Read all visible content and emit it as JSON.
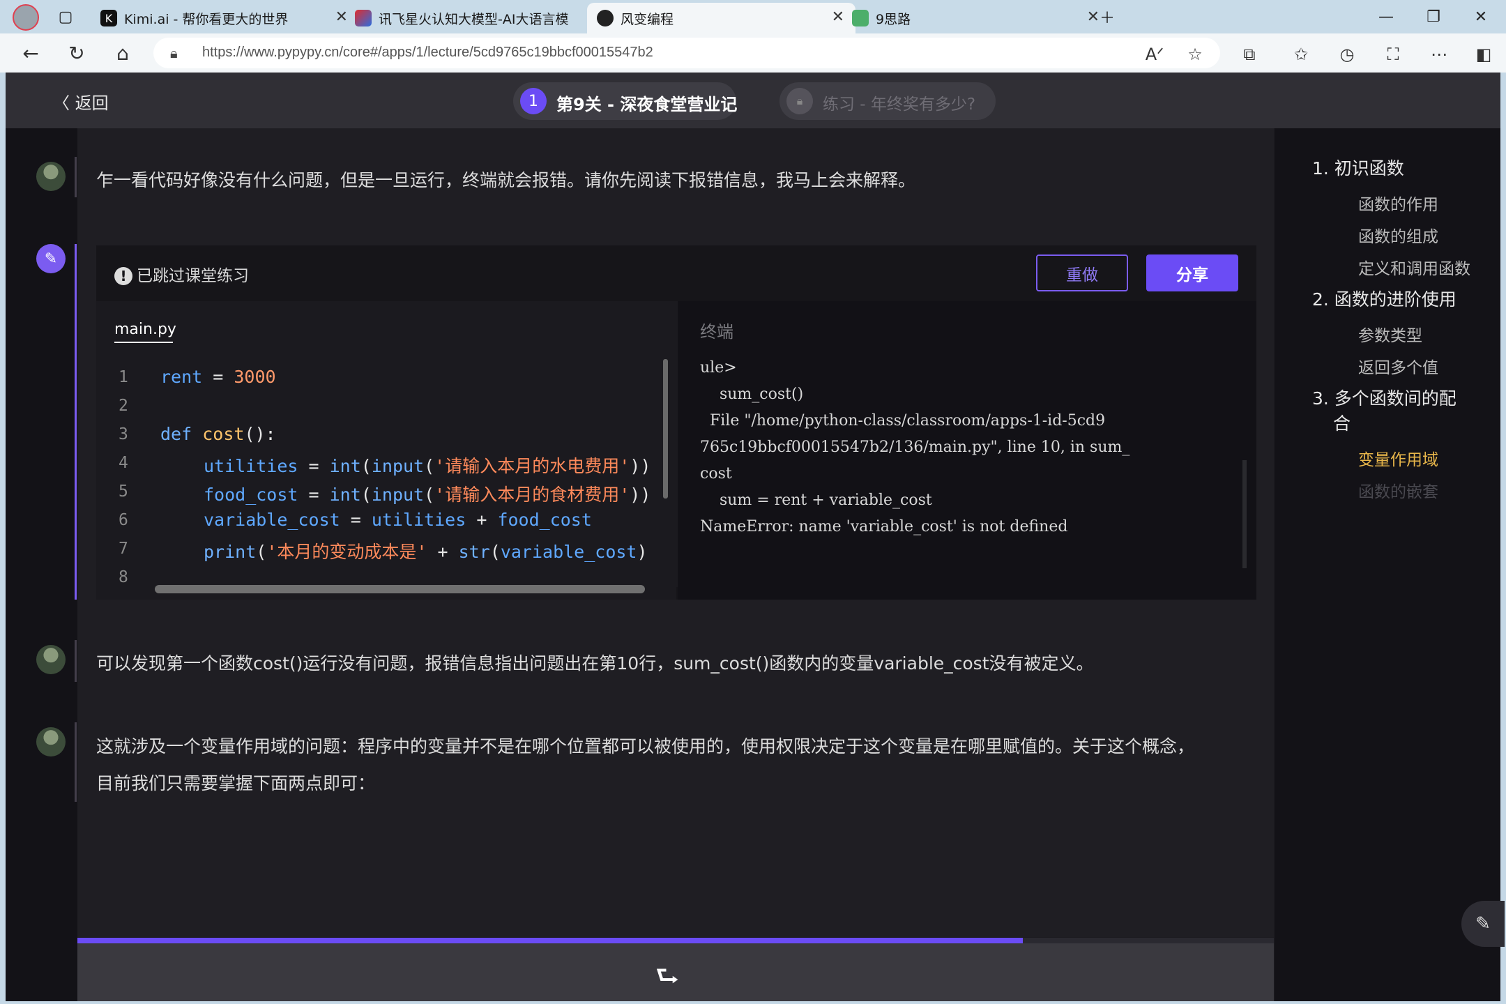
{
  "tabs": [
    {
      "label": "Kimi.ai - 帮你看更大的世界",
      "icon": "kimi-icon"
    },
    {
      "label": "讯飞星火认知大模型-AI大语言模",
      "icon": "spark-icon"
    },
    {
      "label": "风变编程",
      "icon": "panda-icon"
    },
    {
      "label": "9思路",
      "icon": "doc-icon"
    }
  ],
  "address": {
    "url": "https://www.pypypy.cn/core#/apps/1/lecture/5cd9765c19bbcf00015547b2"
  },
  "header": {
    "back_label": "返回",
    "level_num": "1",
    "level_title": "第9关 - 深夜食堂营业记",
    "practice_title": "练习 - 年终奖有多少?"
  },
  "messages": {
    "m1": "乍一看代码好像没有什么问题，但是一旦运行，终端就会报错。请你先阅读下报错信息，我马上会来解释。",
    "m2": "可以发现第一个函数cost()运行没有问题，报错信息指出问题出在第10行，sum_cost()函数内的变量variable_cost没有被定义。",
    "m3a": "这就涉及一个变量作用域的问题：程序中的变量并不是在哪个位置都可以被使用的，使用权限决定于这个变量是在哪里赋值的。关于这个概念，",
    "m3b": "目前我们只需要掌握下面两点即可："
  },
  "exercise": {
    "skipped": "已跳过课堂练习",
    "redo": "重做",
    "share": "分享",
    "filename": "main.py",
    "terminal_label": "终端"
  },
  "code": {
    "line_numbers": [
      "1",
      "2",
      "3",
      "4",
      "5",
      "6",
      "7",
      "8"
    ],
    "rent_var": "rent",
    "rent_val": "3000",
    "def": "def",
    "cost": "cost",
    "def_paren": "():",
    "utilities": "utilities",
    "int": "int",
    "input": "input",
    "str_util": "'请输入本月的水电费用'",
    "food_cost": "food_cost",
    "str_food": "'请输入本月的食材费用'",
    "variable_cost": "variable_cost",
    "print": "print",
    "str_print": "'本月的变动成本是'",
    "str": "str"
  },
  "terminal": [
    "ule>",
    "    sum_cost()",
    "  File \"/home/python-class/classroom/apps-1-id-5cd9",
    "765c19bbcf00015547b2/136/main.py\", line 10, in sum_",
    "cost",
    "    sum = rent + variable_cost",
    "NameError: name 'variable_cost' is not defined"
  ],
  "toc": {
    "s1": "1. 初识函数",
    "s1a": "函数的作用",
    "s1b": "函数的组成",
    "s1c": "定义和调用函数",
    "s2": "2. 函数的进阶使用",
    "s2a": "参数类型",
    "s2b": "返回多个值",
    "s3a": "3. 多个函数间的配",
    "s3b": "合",
    "s3c": "变量作用域",
    "s3d": "函数的嵌套"
  },
  "progress": {
    "fraction": 0.79
  },
  "colors": {
    "accent": "#6b4cf5",
    "toc_active": "#e8b64a"
  }
}
